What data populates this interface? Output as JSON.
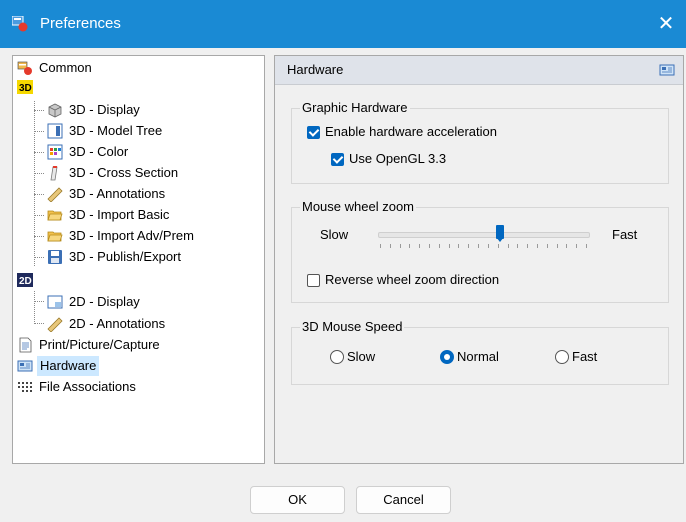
{
  "window": {
    "title": "Preferences",
    "close_glyph": "✕"
  },
  "tree": {
    "items": [
      {
        "label": "Common",
        "icon": "common-settings-icon"
      },
      {
        "label": "3D",
        "icon": "3d-icon"
      },
      {
        "label": "3D - Display",
        "icon": "cube-icon"
      },
      {
        "label": "3D - Model Tree",
        "icon": "model-tree-icon"
      },
      {
        "label": "3D - Color",
        "icon": "palette-icon"
      },
      {
        "label": "3D - Cross Section",
        "icon": "cross-section-icon"
      },
      {
        "label": "3D - Annotations",
        "icon": "ruler-icon"
      },
      {
        "label": "3D - Import Basic",
        "icon": "folder-open-icon"
      },
      {
        "label": "3D - Import Adv/Prem",
        "icon": "folder-open-icon"
      },
      {
        "label": "3D - Publish/Export",
        "icon": "save-icon"
      },
      {
        "label": "2D",
        "icon": "2d-icon"
      },
      {
        "label": "2D - Display",
        "icon": "window-icon"
      },
      {
        "label": "2D - Annotations",
        "icon": "ruler-icon"
      },
      {
        "label": "Print/Picture/Capture",
        "icon": "document-icon"
      },
      {
        "label": "Hardware",
        "icon": "hardware-icon",
        "selected": true
      },
      {
        "label": "File Associations",
        "icon": "file-associations-icon"
      }
    ]
  },
  "panel": {
    "header": "Hardware",
    "graphic": {
      "title": "Graphic Hardware",
      "enable_accel": {
        "label": "Enable hardware acceleration",
        "checked": true
      },
      "opengl": {
        "label": "Use OpenGL 3.3",
        "checked": true
      }
    },
    "zoom": {
      "title": "Mouse wheel zoom",
      "slow": "Slow",
      "fast": "Fast",
      "level": 0.58,
      "reverse": {
        "label": "Reverse wheel zoom direction",
        "checked": false
      }
    },
    "speed": {
      "title": "3D Mouse Speed",
      "options": [
        {
          "label": "Slow",
          "selected": false
        },
        {
          "label": "Normal",
          "selected": true
        },
        {
          "label": "Fast",
          "selected": false
        }
      ]
    }
  },
  "buttons": {
    "ok": "OK",
    "cancel": "Cancel"
  },
  "colors": {
    "titlebar": "#1a8ad4",
    "accent": "#0067c0",
    "selection": "#cce8ff"
  }
}
